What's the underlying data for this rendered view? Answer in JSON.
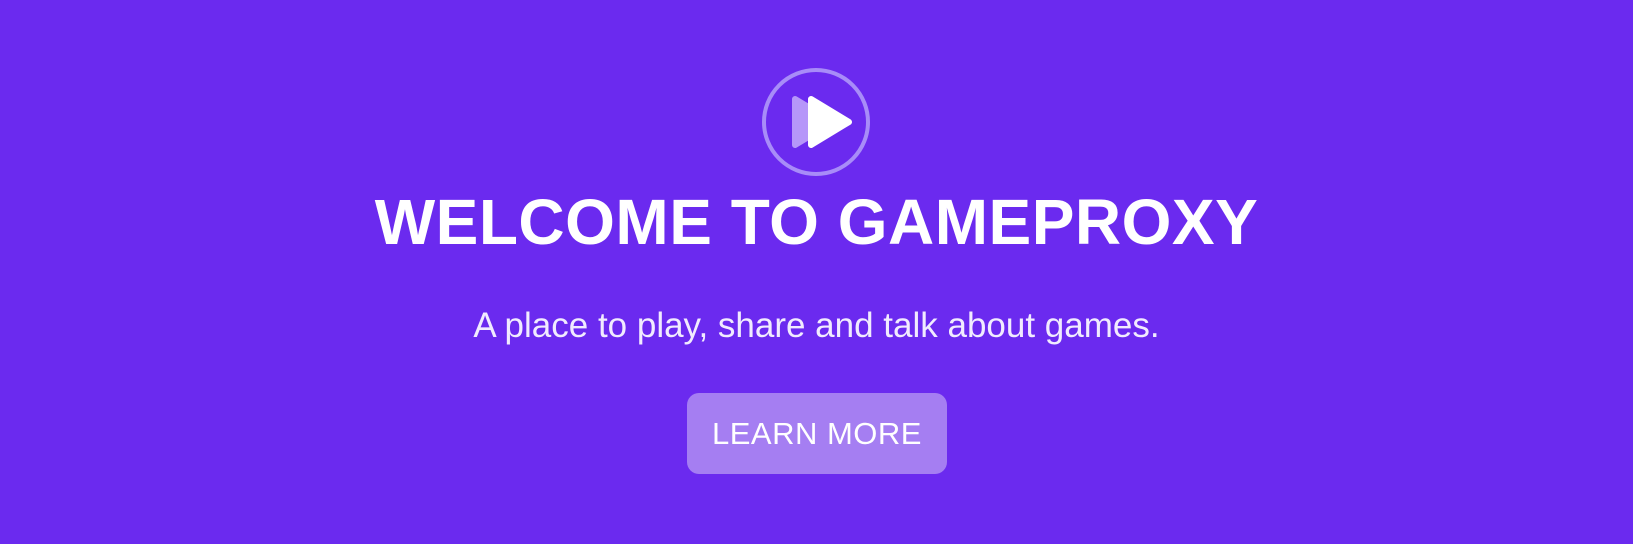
{
  "hero": {
    "logo_icon": "play-forward-icon",
    "title": "WELCOME TO GAMEPROXY",
    "subtitle": "A place to play, share and talk about games.",
    "cta_label": "LEARN MORE"
  },
  "colors": {
    "background": "#6b2aef",
    "button": "#a57ef2",
    "logo_ring": "#a88cf8",
    "logo_back_triangle": "#b697f9",
    "text": "#ffffff"
  }
}
